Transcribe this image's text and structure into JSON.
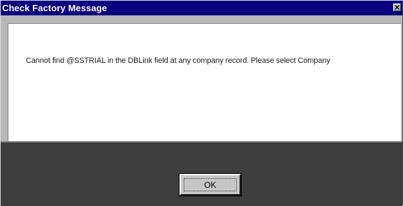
{
  "dialog": {
    "title": "Check Factory Message",
    "close_icon": "close-icon",
    "message": "Cannot find @SSTRIAL in the DBLink field at any company record. Please select Company",
    "ok_label": "OK"
  },
  "colors": {
    "titlebar": "#0a007f",
    "title_text": "#ffffff",
    "window_face": "#b8b8b8",
    "message_background": "#ffffff",
    "button_area": "#3d3d3d",
    "button_face": "#c6c6c6"
  }
}
